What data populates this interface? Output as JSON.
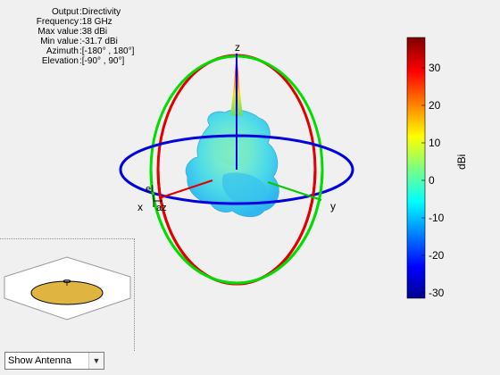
{
  "info": [
    {
      "label": "Output",
      "value": "Directivity"
    },
    {
      "label": "Frequency",
      "value": "18 GHz"
    },
    {
      "label": "Max value",
      "value": "38 dBi"
    },
    {
      "label": "Min value",
      "value": "-31.7 dBi"
    },
    {
      "label": "Azimuth",
      "value": "[-180° , 180°]"
    },
    {
      "label": "Elevation",
      "value": "[-90° , 90°]"
    }
  ],
  "axes": {
    "z": "z",
    "x": "x",
    "y": "y",
    "el": "el",
    "az": "az"
  },
  "colorbar": {
    "unit": "dBi",
    "ticks": [
      "30",
      "20",
      "10",
      "0",
      "-10",
      "-20",
      "-30"
    ]
  },
  "dropdown": {
    "selected": "Show Antenna"
  },
  "colors": {
    "azimuth_circle": "#0000e0",
    "elevation_circle_red": "#e00000",
    "elevation_circle_green": "#00e000",
    "antenna_patch": "#e0b440"
  }
}
